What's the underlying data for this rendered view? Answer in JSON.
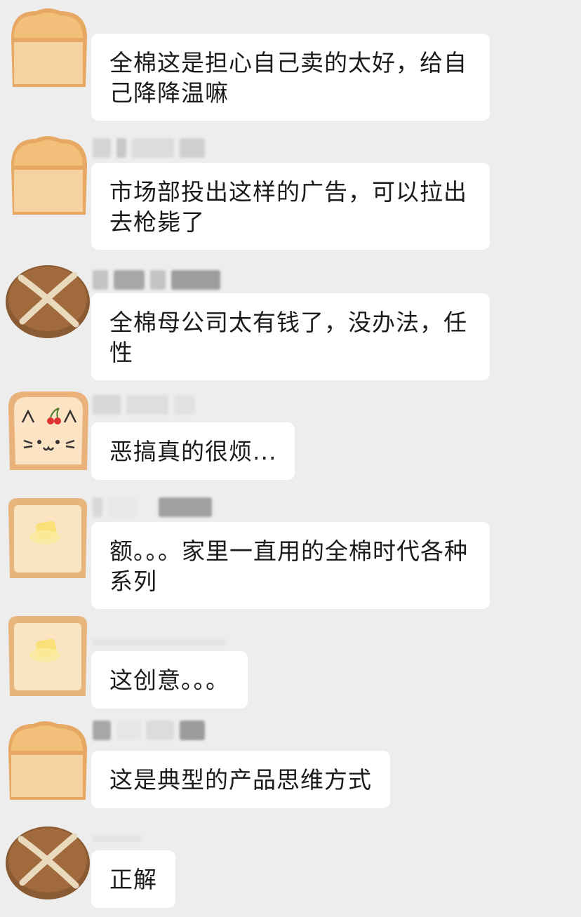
{
  "messages": [
    {
      "avatar": "loaf-bread-icon",
      "text": "全棉这是担心自己卖的太好，给自己降降温嘛"
    },
    {
      "avatar": "loaf-bread-icon",
      "text": "市场部投出这样的广告，可以拉出去枪毙了"
    },
    {
      "avatar": "round-bread-icon",
      "text": "全棉母公司太有钱了，没办法，任性"
    },
    {
      "avatar": "cat-toast-icon",
      "text": "恶搞真的很烦..."
    },
    {
      "avatar": "butter-toast-icon",
      "text": "额。。。家里一直用的全棉时代各种系列"
    },
    {
      "avatar": "butter-toast-icon",
      "text": "这创意。。。"
    },
    {
      "avatar": "loaf-bread-icon",
      "text": "这是典型的产品思维方式"
    },
    {
      "avatar": "round-bread-icon",
      "text": "正解"
    }
  ],
  "colors": {
    "background": "#ededed",
    "bubble": "#ffffff",
    "text": "#1b1b1b"
  }
}
